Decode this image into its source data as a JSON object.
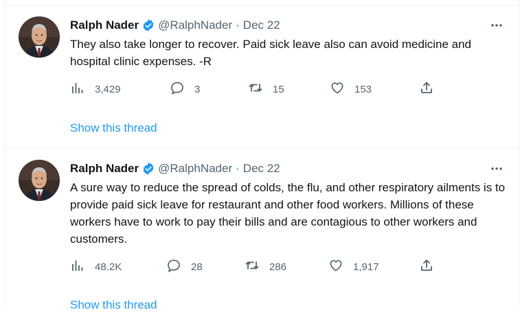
{
  "tweets": [
    {
      "author_name": "Ralph Nader",
      "handle": "@RalphNader",
      "separator": "·",
      "date": "Dec 22",
      "text": "They also take longer to recover. Paid sick leave also can avoid medicine and hospital clinic expenses. -R",
      "metrics": {
        "views": "3,429",
        "replies": "3",
        "retweets": "15",
        "likes": "153"
      },
      "thread_link": "Show this thread"
    },
    {
      "author_name": "Ralph Nader",
      "handle": "@RalphNader",
      "separator": "·",
      "date": "Dec 22",
      "text": "A sure way to reduce the spread of colds, the flu, and other respiratory ailments is to provide paid sick leave for restaurant and other food workers. Millions of these workers have to work to pay their bills and are contagious to other workers and customers.",
      "metrics": {
        "views": "48.2K",
        "replies": "28",
        "retweets": "286",
        "likes": "1,917"
      },
      "thread_link": "Show this thread"
    }
  ],
  "colors": {
    "link": "#1d9bf0",
    "verified": "#1d9bf0",
    "muted": "#536471",
    "divider": "#eff3f4"
  },
  "icons": [
    "verified-badge-icon",
    "more-icon",
    "views-icon",
    "reply-icon",
    "retweet-icon",
    "like-icon",
    "share-icon"
  ]
}
